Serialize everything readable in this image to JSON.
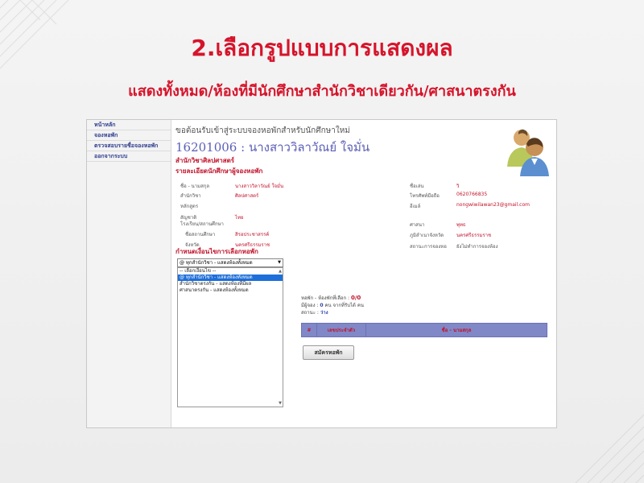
{
  "slide": {
    "title": "2.เลือกรูปแบบการแสดงผล",
    "subtitle": "แสดงทั้งหมด/ห้องที่มีนักศึกษาสำนักวิชาเดียวกัน/ศาสนาตรงกัน"
  },
  "sidebar": {
    "items": [
      {
        "label": "หน้าหลัก"
      },
      {
        "label": "จองหอพัก"
      },
      {
        "label": "ตรวจสอบรายชื่อจองหอพัก"
      },
      {
        "label": "ออกจากระบบ"
      }
    ]
  },
  "header": {
    "welcome": "ขอต้อนรับเข้าสู่ระบบจองหอพักสำหรับนักศึกษาใหม่",
    "student": "16201006 : นางสาววิลาวัณย์ ใจมั่น",
    "faculty": "สำนักวิชาศิลปศาสตร์",
    "detail_heading": "รายละเอียดนักศึกษาผู้จองหอพัก"
  },
  "profile_left": [
    {
      "label": "ชื่อ - นามสกุล",
      "value": "นางสาววิลาวัณย์ ใจมั่น"
    },
    {
      "label": "สำนักวิชา",
      "value": "ศิลปศาสตร์"
    },
    {
      "label": "หลักสูตร",
      "value": ""
    },
    {
      "label": "สัญชาติ",
      "value": "ไทย"
    },
    {
      "label": "โรงเรียน/สถานศึกษา",
      "value": ""
    },
    {
      "label": "ชื่อสถานศึกษา",
      "value": "สิรอประชาสรรค์"
    },
    {
      "label": "จังหวัด",
      "value": "นครศรีธรรมราช"
    }
  ],
  "profile_right": [
    {
      "label": "ชื่อเล่น",
      "value": "วิ"
    },
    {
      "label": "โทรศัพท์มือถือ",
      "value": "0620766835"
    },
    {
      "label": "อีเมล์",
      "value": "nongwiwilawan23@gmail.com"
    },
    {
      "label": "ศาสนา",
      "value": "พุทธ"
    },
    {
      "label": "ภูมิลำเนาจังหวัด",
      "value": "นครศรีธรรมราช"
    },
    {
      "label": "สถานะการจองหอ",
      "value": "ยังไม่ทำการจองห้อง"
    }
  ],
  "booking": {
    "section_heading": "กำหนดเงื่อนไขการเลือกหอพัก",
    "select_value": "@ ทุกสำนักวิชา - แสดงห้องทั้งหมด",
    "options": [
      "-- เลือกเงื่อนไข --",
      "@ ทุกสำนักวิชา - แสดงห้องทั้งหมด",
      "สำนักวิชาตรงกัน - แสดงห้องที่มีผล",
      "ศาสนาตรงกัน - แสดงห้องทั้งหมด"
    ],
    "selected_index": 1,
    "room_label": "หอพัก - ห้องพักที่เลือก :",
    "room_value": "0/0",
    "occupant_prefix": "มีผู้จอง :",
    "occupant_count": "0",
    "occupant_suffix": "คน จากที่รับได้",
    "occupant_unit": "คน",
    "status_label": "สถานะ :",
    "status_value": "ว่าง",
    "table_headers": [
      "#",
      "เลขประจำตัว",
      "ชื่อ - นามสกุล"
    ],
    "apply_button": "สมัครหอพัก"
  },
  "colors": {
    "accent_red": "#d6142b",
    "link_blue": "#2f3f8f",
    "table_header": "#8088c8"
  }
}
